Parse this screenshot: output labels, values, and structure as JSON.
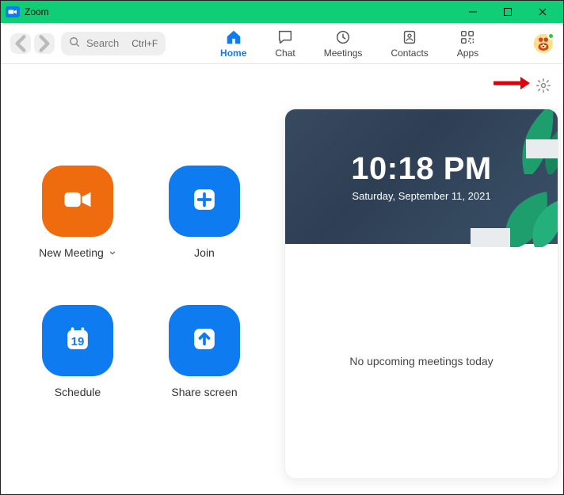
{
  "window": {
    "title": "Zoom"
  },
  "search": {
    "placeholder": "Search",
    "shortcut": "Ctrl+F"
  },
  "tabs": {
    "home": "Home",
    "chat": "Chat",
    "meetings": "Meetings",
    "contacts": "Contacts",
    "apps": "Apps"
  },
  "actions": {
    "new_meeting": "New Meeting",
    "join": "Join",
    "schedule": "Schedule",
    "schedule_day": "19",
    "share_screen": "Share screen"
  },
  "panel": {
    "time": "10:18 PM",
    "date": "Saturday, September 11, 2021",
    "empty": "No upcoming meetings today"
  }
}
